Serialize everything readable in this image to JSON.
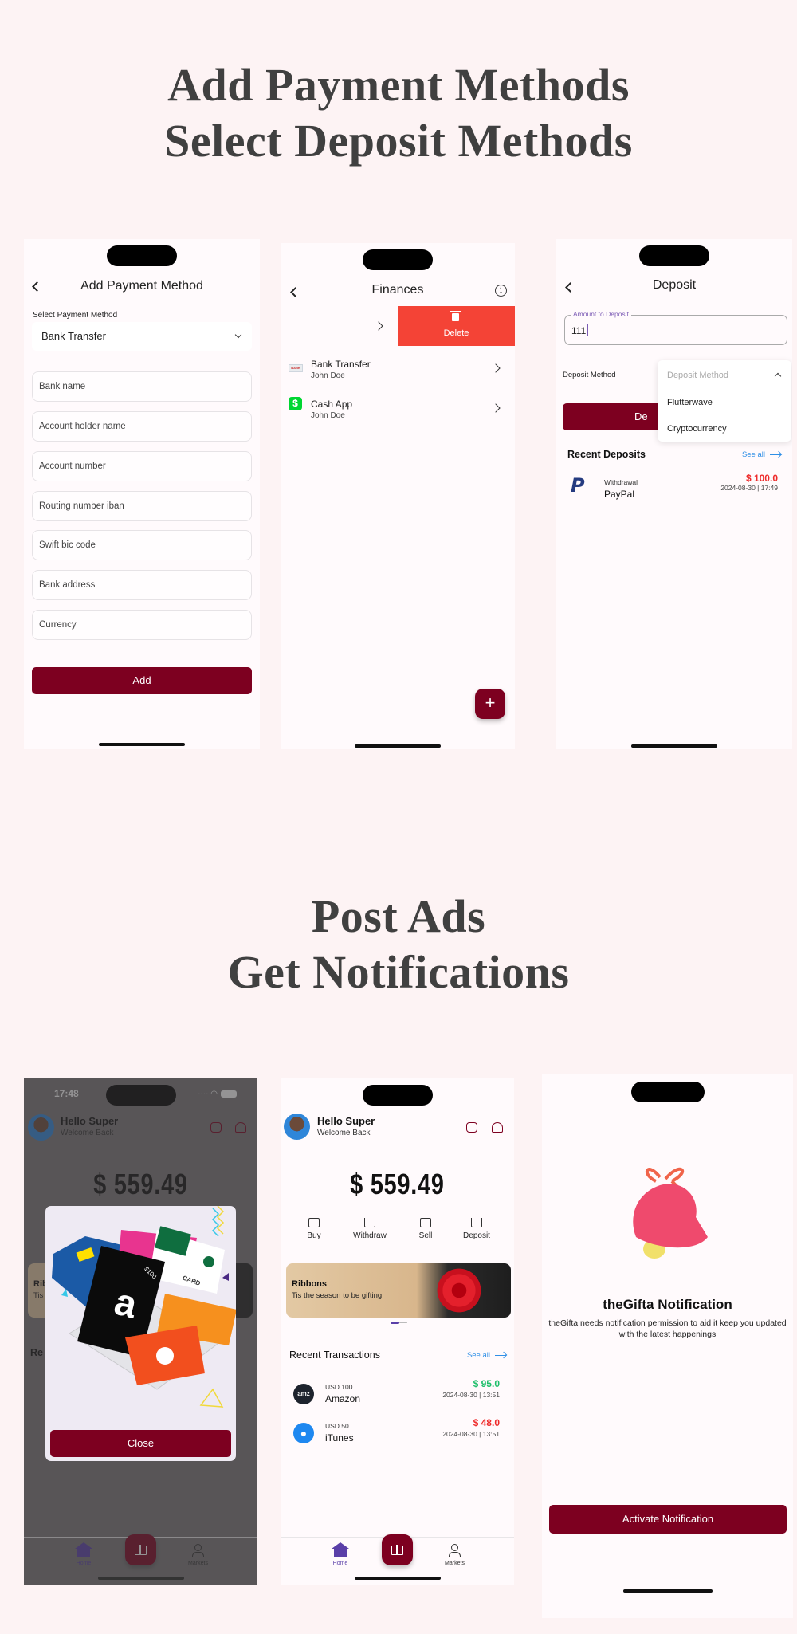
{
  "headlines": {
    "top": [
      "Add Payment Methods",
      "Select Deposit Methods"
    ],
    "bottom": [
      "Post Ads",
      "Get Notifications"
    ]
  },
  "colors": {
    "brand": "#7d0020",
    "delete": "#f44336",
    "positive": "#1fbf6b",
    "negative": "#ee2b2b",
    "link": "#2f8fe6",
    "nav_active": "#5a3fa8"
  },
  "add_payment": {
    "title": "Add Payment Method",
    "back_icon": "chevron-left-icon",
    "select_label": "Select Payment Method",
    "selected_method": "Bank Transfer",
    "fields": [
      {
        "placeholder": "Bank name"
      },
      {
        "placeholder": "Account holder name"
      },
      {
        "placeholder": "Account number"
      },
      {
        "placeholder": "Routing number iban"
      },
      {
        "placeholder": "Swift bic code"
      },
      {
        "placeholder": "Bank address"
      },
      {
        "placeholder": "Currency"
      }
    ],
    "add_label": "Add"
  },
  "finances": {
    "title": "Finances",
    "delete_label": "Delete",
    "items": [
      {
        "title": "Bank Transfer",
        "subtitle": "John Doe",
        "icon": "bank-logo"
      },
      {
        "title": "Cash App",
        "subtitle": "John Doe",
        "icon": "cash-app-logo",
        "icon_glyph": "$"
      }
    ],
    "fab_label": "+"
  },
  "deposit": {
    "title": "Deposit",
    "amount_label": "Amount to Deposit",
    "amount_value": "111",
    "method_label": "Deposit Method",
    "dropdown": {
      "placeholder": "Deposit Method",
      "options": [
        "Flutterwave",
        "Cryptocurrency"
      ]
    },
    "deposit_button_partial": "De",
    "recent_title": "Recent Deposits",
    "see_all": "See all",
    "recent": [
      {
        "type": "Withdrawal",
        "name": "PayPal",
        "amount": "$ 100.0",
        "date": "2024-08-30 | 17:49"
      }
    ]
  },
  "home": {
    "time": "17:48",
    "greeting": "Hello Super",
    "subgreeting": "Welcome Back",
    "balance": "$ 559.49",
    "actions": [
      "Buy",
      "Withdraw",
      "Sell",
      "Deposit"
    ],
    "banner": {
      "title": "Ribbons",
      "subtitle": "Tis the season to be gifting"
    },
    "carousel": {
      "active_index": 0,
      "count": 2
    },
    "transactions_title": "Recent Transactions",
    "see_all": "See all",
    "transactions": [
      {
        "small": "USD 100",
        "name": "Amazon",
        "amount": "$ 95.0",
        "date": "2024-08-30 | 13:51",
        "status": "positive"
      },
      {
        "small": "USD 50",
        "name": "iTunes",
        "amount": "$ 48.0",
        "date": "2024-08-30 | 13:51",
        "status": "negative"
      }
    ],
    "nav": {
      "home": "Home",
      "markets": "Markets"
    },
    "partial_banner": {
      "title": "Rib",
      "subtitle": "Tis"
    },
    "partial_section": "Re",
    "ad": {
      "card_value": "$100",
      "card_text": "CARD",
      "close_label": "Close"
    }
  },
  "notification": {
    "title": "theGifta Notification",
    "text": "theGifta needs notification permission to aid it keep you updated with the latest happenings",
    "button": "Activate Notification"
  }
}
